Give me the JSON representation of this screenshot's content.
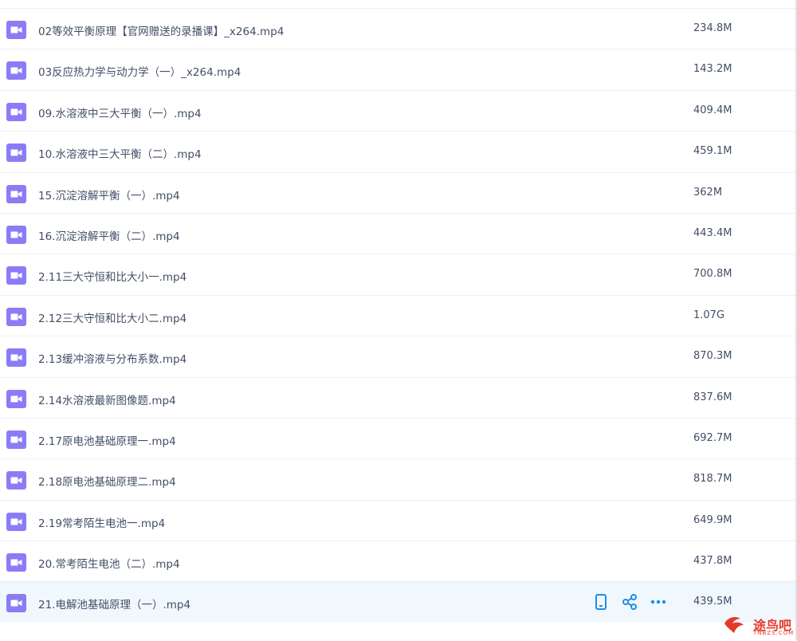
{
  "files": [
    {
      "name": "02等效平衡原理【官网赠送的录播课】_x264.mp4",
      "size": "234.8M",
      "icon": "video-file-icon"
    },
    {
      "name": "03反应热力学与动力学（一）_x264.mp4",
      "size": "143.2M",
      "icon": "video-file-icon"
    },
    {
      "name": "09.水溶液中三大平衡（一）.mp4",
      "size": "409.4M",
      "icon": "video-file-icon"
    },
    {
      "name": "10.水溶液中三大平衡（二）.mp4",
      "size": "459.1M",
      "icon": "video-file-icon"
    },
    {
      "name": "15.沉淀溶解平衡（一）.mp4",
      "size": "362M",
      "icon": "video-file-icon"
    },
    {
      "name": "16.沉淀溶解平衡（二）.mp4",
      "size": "443.4M",
      "icon": "video-file-icon"
    },
    {
      "name": "2.11三大守恒和比大小一.mp4",
      "size": "700.8M",
      "icon": "video-file-icon"
    },
    {
      "name": "2.12三大守恒和比大小二.mp4",
      "size": "1.07G",
      "icon": "video-file-icon"
    },
    {
      "name": "2.13缓冲溶液与分布系数.mp4",
      "size": "870.3M",
      "icon": "video-file-icon"
    },
    {
      "name": "2.14水溶液最新图像题.mp4",
      "size": "837.6M",
      "icon": "video-file-icon"
    },
    {
      "name": "2.17原电池基础原理一.mp4",
      "size": "692.7M",
      "icon": "video-file-icon"
    },
    {
      "name": "2.18原电池基础原理二.mp4",
      "size": "818.7M",
      "icon": "video-file-icon"
    },
    {
      "name": "2.19常考陌生电池一.mp4",
      "size": "649.9M",
      "icon": "video-file-icon"
    },
    {
      "name": "20.常考陌生电池（二）.mp4",
      "size": "437.8M",
      "icon": "video-file-icon"
    },
    {
      "name": "21.电解池基础原理（一）.mp4",
      "size": "439.5M",
      "icon": "video-file-icon",
      "hovered": true
    }
  ],
  "row_actions": [
    {
      "icon": "phone-icon"
    },
    {
      "icon": "share-icon"
    },
    {
      "icon": "more-icon"
    }
  ],
  "watermark": {
    "text": "途鸟吧",
    "sub": "TNBZS.COM"
  },
  "colors": {
    "icon_purple": "#8b7cf6",
    "text": "#424e67",
    "hover_bg": "#f0f8fd",
    "action_blue": "#1e8ee6",
    "watermark_red": "#e5392c"
  }
}
